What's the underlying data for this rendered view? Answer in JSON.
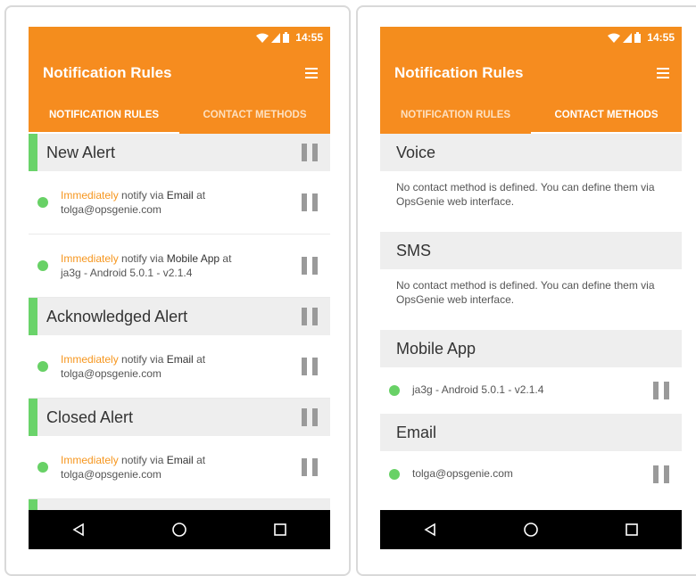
{
  "status_bar": {
    "time": "14:55"
  },
  "app_bar": {
    "title": "Notification Rules"
  },
  "tabs": [
    {
      "label": "NOTIFICATION RULES"
    },
    {
      "label": "CONTACT METHODS"
    }
  ],
  "notification_rules": {
    "sections": [
      {
        "title": "New Alert",
        "rules": [
          {
            "timing": "Immediately",
            "mid": " notify via ",
            "method": "Email",
            "suffix": " at",
            "target": "tolga@opsgenie.com"
          },
          {
            "timing": "Immediately",
            "mid": " notify via ",
            "method": "Mobile App",
            "suffix": " at",
            "target": "ja3g - Android 5.0.1 - v2.1.4"
          }
        ]
      },
      {
        "title": "Acknowledged Alert",
        "rules": [
          {
            "timing": "Immediately",
            "mid": " notify via ",
            "method": "Email",
            "suffix": " at",
            "target": "tolga@opsgenie.com"
          }
        ]
      },
      {
        "title": "Closed Alert",
        "rules": [
          {
            "timing": "Immediately",
            "mid": " notify via ",
            "method": "Email",
            "suffix": " at",
            "target": "tolga@opsgenie.com"
          }
        ]
      }
    ]
  },
  "contact_methods": {
    "voice": {
      "title": "Voice",
      "empty_text": "No contact method is defined. You can define them via OpsGenie web interface."
    },
    "sms": {
      "title": "SMS",
      "empty_text": "No contact method is defined. You can define them via OpsGenie web interface."
    },
    "mobile_app": {
      "title": "Mobile App",
      "item": "ja3g - Android 5.0.1 - v2.1.4"
    },
    "email": {
      "title": "Email",
      "item": "tolga@opsgenie.com"
    }
  },
  "icons": {
    "status": [
      "wifi-icon",
      "signal-icon",
      "battery-icon"
    ],
    "menu": "hamburger-menu-icon",
    "pause": "pause-icon",
    "nav": [
      "back-icon",
      "home-icon",
      "recents-icon"
    ]
  },
  "colors": {
    "brand_orange": "#f68c1f",
    "status_green": "#68d166",
    "highlight_orange": "#f6961e",
    "nav_black": "#000000"
  }
}
